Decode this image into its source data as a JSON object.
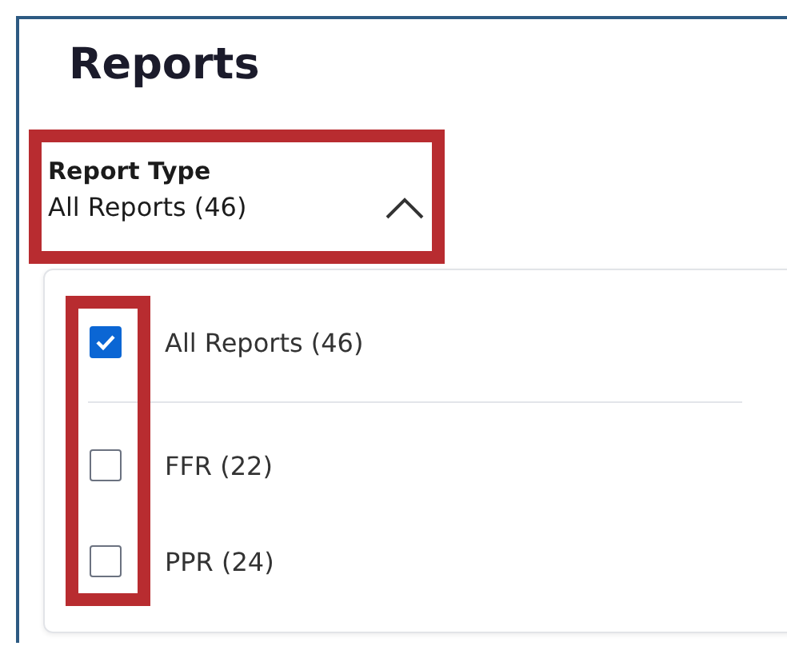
{
  "title": "Reports",
  "dropdown": {
    "label": "Report Type",
    "value": "All Reports (46)",
    "expanded": true,
    "highlighted": true
  },
  "menu": {
    "checkboxes_highlighted": true,
    "options": [
      {
        "label": "All Reports (46)",
        "checked": true
      },
      {
        "label": "FFR (22)",
        "checked": false
      },
      {
        "label": "PPR (24)",
        "checked": false
      }
    ]
  }
}
